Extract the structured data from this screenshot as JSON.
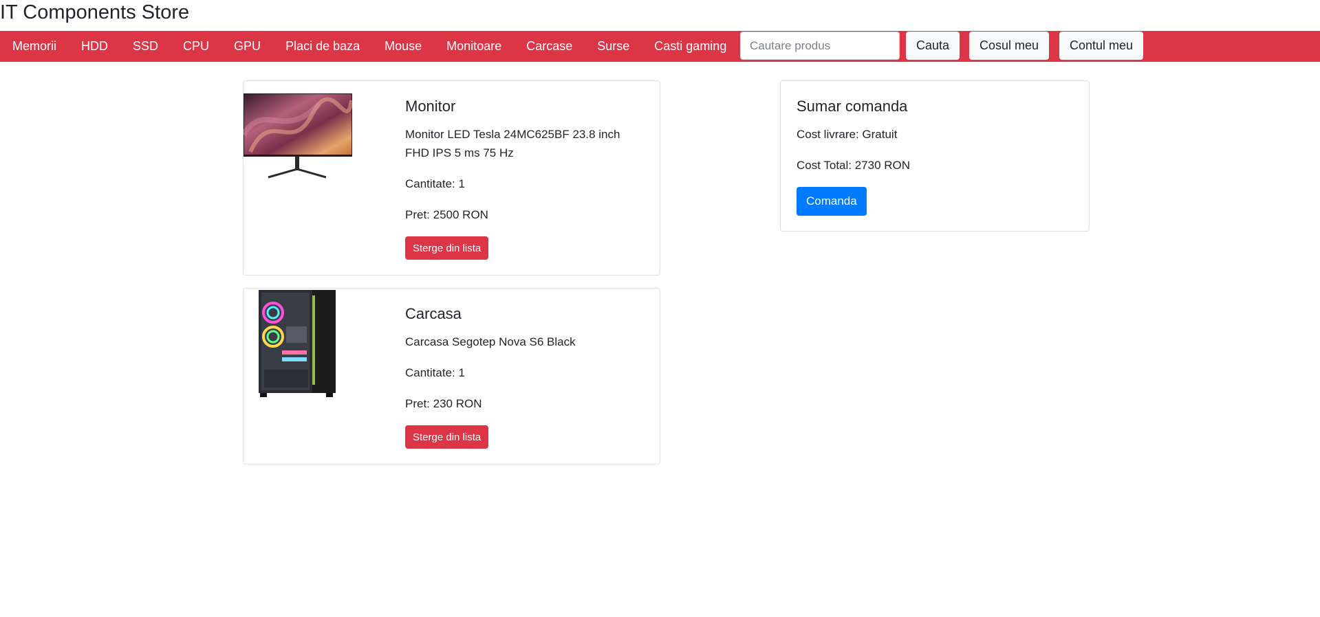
{
  "header": {
    "title": "IT Components Store"
  },
  "nav": {
    "items": [
      "Memorii",
      "HDD",
      "SSD",
      "CPU",
      "GPU",
      "Placi de baza",
      "Mouse",
      "Monitoare",
      "Carcase",
      "Surse",
      "Casti gaming"
    ],
    "search_placeholder": "Cautare produs",
    "search_value": "",
    "search_button": "Cauta",
    "cart_button": "Cosul meu",
    "account_button": "Contul meu"
  },
  "cart": {
    "items": [
      {
        "name": "Monitor",
        "description": "Monitor LED Tesla 24MC625BF 23.8 inch FHD IPS 5 ms 75 Hz",
        "quantity": "Cantitate: 1",
        "price": "Pret: 2500 RON",
        "remove_label": "Sterge din lista"
      },
      {
        "name": "Carcasa",
        "description": "Carcasa Segotep Nova S6 Black",
        "quantity": "Cantitate: 1",
        "price": "Pret: 230 RON",
        "remove_label": "Sterge din lista"
      }
    ]
  },
  "summary": {
    "title": "Sumar comanda",
    "delivery": "Cost livrare: Gratuit",
    "total": "Cost Total: 2730 RON",
    "order_button": "Comanda"
  },
  "colors": {
    "navbar": "#dc3545",
    "primary": "#007bff",
    "danger": "#dc3545"
  }
}
